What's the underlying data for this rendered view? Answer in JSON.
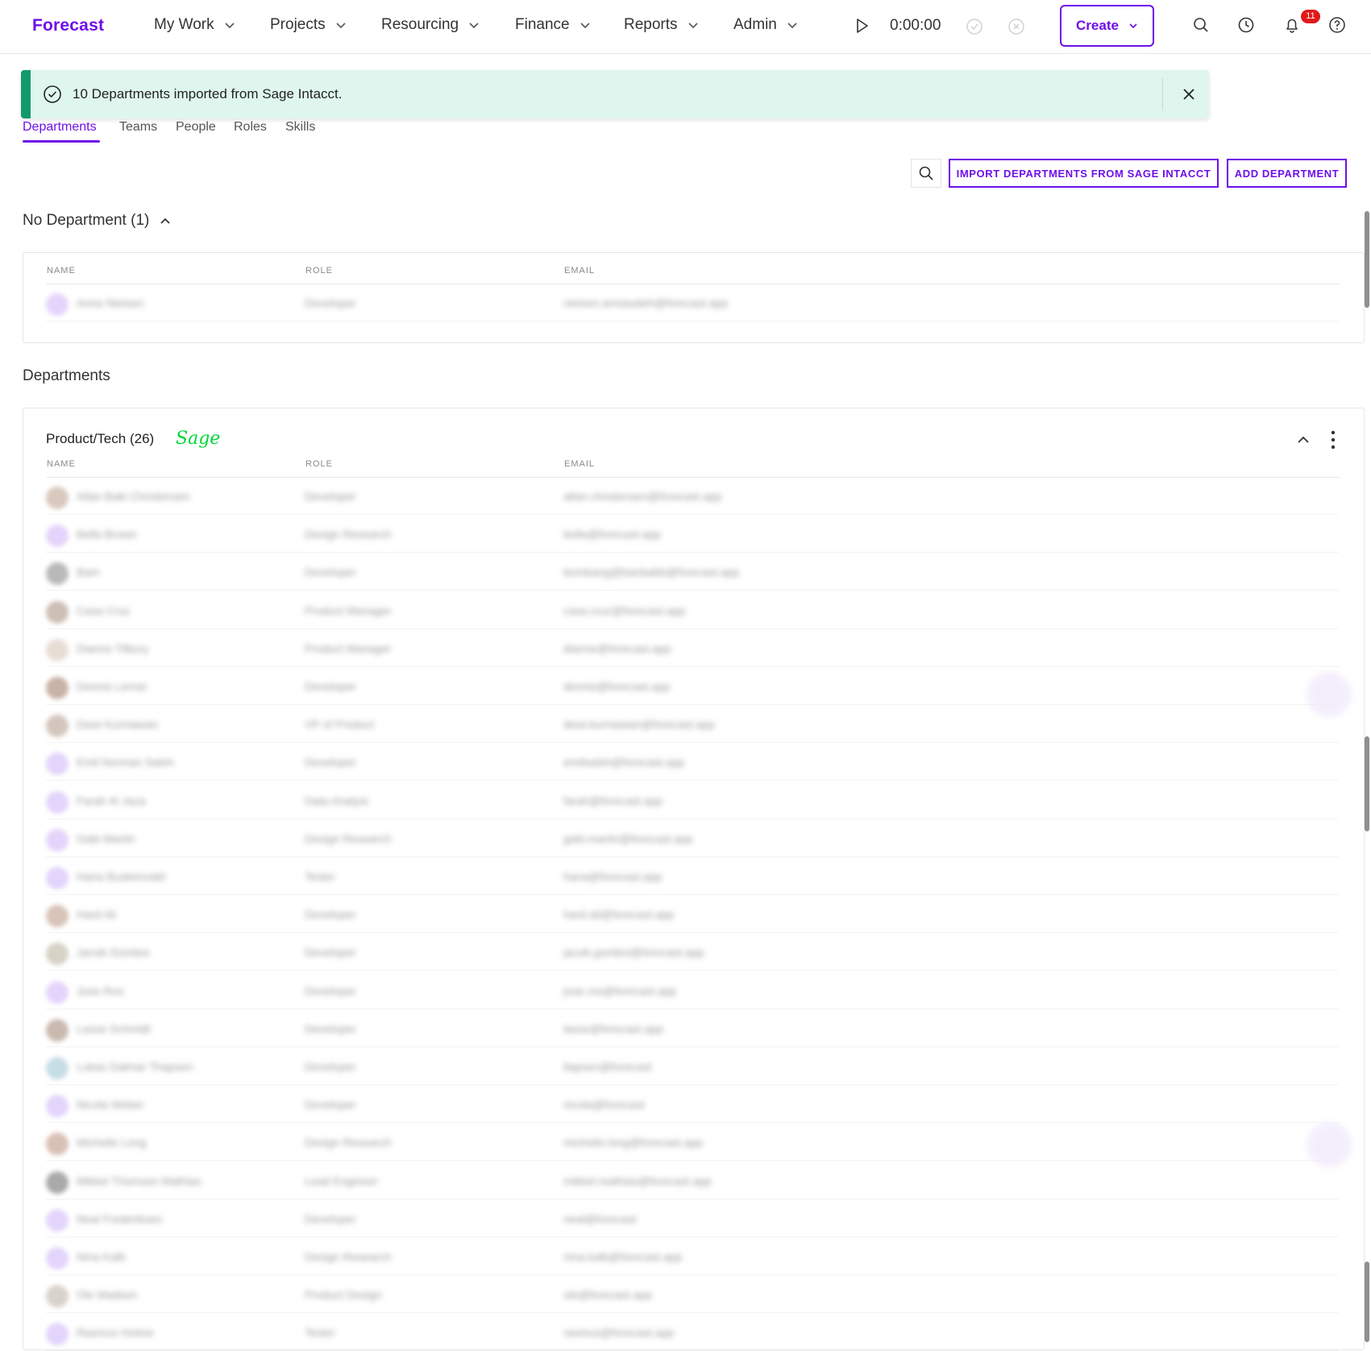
{
  "nav": {
    "logo": "Forecast",
    "items": [
      "My Work",
      "Projects",
      "Resourcing",
      "Finance",
      "Reports",
      "Admin"
    ],
    "timer": "0:00:00",
    "create_label": "Create",
    "notification_count": "11",
    "icons": [
      "play-icon",
      "check-circle-icon",
      "x-circle-icon",
      "search-icon",
      "history-icon",
      "bell-icon",
      "help-icon"
    ]
  },
  "toast": {
    "message": "10 Departments imported from Sage Intacct.",
    "color": "#dff6ef",
    "accent": "#129a6c"
  },
  "tabs": [
    "Departments",
    "Teams",
    "People",
    "Roles",
    "Skills"
  ],
  "toolbar": {
    "import_label": "IMPORT DEPARTMENTS FROM SAGE INTACCT",
    "add_label": "ADD DEPARTMENT"
  },
  "no_department": {
    "title": "No Department",
    "count": "(1)",
    "columns": [
      "NAME",
      "ROLE",
      "EMAIL"
    ],
    "rows": [
      {
        "name": "Anna Nielsen",
        "role": "Developer",
        "email": "nielsen.annasaleh@forecast.app",
        "avatar": "#e3d4fb"
      }
    ]
  },
  "departments_heading": "Departments",
  "department": {
    "name": "Product/Tech",
    "count": "(26)",
    "integration_logo": "Sage",
    "columns": [
      "NAME",
      "ROLE",
      "EMAIL"
    ],
    "rows": [
      {
        "name": "Allan Baki Christensen",
        "role": "Developer",
        "email": "allan.christensen@forecast.app",
        "avatar": "#d9c8bd"
      },
      {
        "name": "Bella Brown",
        "role": "Design Research",
        "email": "bella@forecast.app",
        "avatar": "#e3d4fb"
      },
      {
        "name": "Bam",
        "role": "Developer",
        "email": "bombang@banbabb@forecast.app",
        "avatar": "#b9b9b9"
      },
      {
        "name": "Casa Cruz",
        "role": "Product Manager",
        "email": "casa.cruz@forecast.app",
        "avatar": "#cdbfb5"
      },
      {
        "name": "Dianne Tilbury",
        "role": "Product Manager",
        "email": "dianne@forecast.app",
        "avatar": "#e8ddd5"
      },
      {
        "name": "Dennis Lerner",
        "role": "Developer",
        "email": "dennis@forecast.app",
        "avatar": "#c8b3a6"
      },
      {
        "name": "Dewi Kurniawan",
        "role": "VP of Product",
        "email": "dewi.kurniawan@forecast.app",
        "avatar": "#d4c6bd"
      },
      {
        "name": "Emil Norman Saleh",
        "role": "Developer",
        "email": "emilsaleh@forecast.app",
        "avatar": "#e3d4fb"
      },
      {
        "name": "Farah Al Jaza",
        "role": "Data Analyst",
        "email": "farah@forecast.app",
        "avatar": "#e3d4fb"
      },
      {
        "name": "Gabi Martin",
        "role": "Design Research",
        "email": "gabi.martin@forecast.app",
        "avatar": "#e3d4fb"
      },
      {
        "name": "Hana Buskenvald",
        "role": "Tester",
        "email": "hana@forecast.app",
        "avatar": "#e3d4fb"
      },
      {
        "name": "Hard Ali",
        "role": "Developer",
        "email": "hard.ali@forecast.app",
        "avatar": "#d8c4b8"
      },
      {
        "name": "Jacob Gomboi",
        "role": "Developer",
        "email": "jacob.gomboi@forecast.app",
        "avatar": "#d6d2c4"
      },
      {
        "name": "Jose Ros",
        "role": "Developer",
        "email": "jose.ros@forecast.app",
        "avatar": "#e3d4fb"
      },
      {
        "name": "Lasse Schmidt",
        "role": "Developer",
        "email": "lasse@forecast.app",
        "avatar": "#c9b9ae"
      },
      {
        "name": "Lukas Dalmar Thapsen",
        "role": "Developer",
        "email": "ltapsen@forecast",
        "avatar": "#c7dde6"
      },
      {
        "name": "Nicola Weber",
        "role": "Developer",
        "email": "nicola@forecast",
        "avatar": "#e3d4fb"
      },
      {
        "name": "Michelle Long",
        "role": "Design Research",
        "email": "michelle.long@forecast.app",
        "avatar": "#d8bfb4"
      },
      {
        "name": "Mikkel Thomsen Mathias",
        "role": "Lead Engineer",
        "email": "mikkel.mathias@forecast.app",
        "avatar": "#a9a9a9"
      },
      {
        "name": "Neal Frederiksen",
        "role": "Developer",
        "email": "neal@forecast",
        "avatar": "#e3d4fb"
      },
      {
        "name": "Nina Kalb",
        "role": "Design Research",
        "email": "nina.kalb@forecast.app",
        "avatar": "#e3d4fb"
      },
      {
        "name": "Ole Madsen",
        "role": "Product Design",
        "email": "ole@forecast.app",
        "avatar": "#d9d2cc"
      },
      {
        "name": "Rasmus Holme",
        "role": "Tester",
        "email": "rasmus@forecast.app",
        "avatar": "#e3d4fb"
      }
    ]
  },
  "colors": {
    "brand": "#6e0fea",
    "success": "#129a6c",
    "sage": "#00d639",
    "badge": "#e0191b"
  }
}
